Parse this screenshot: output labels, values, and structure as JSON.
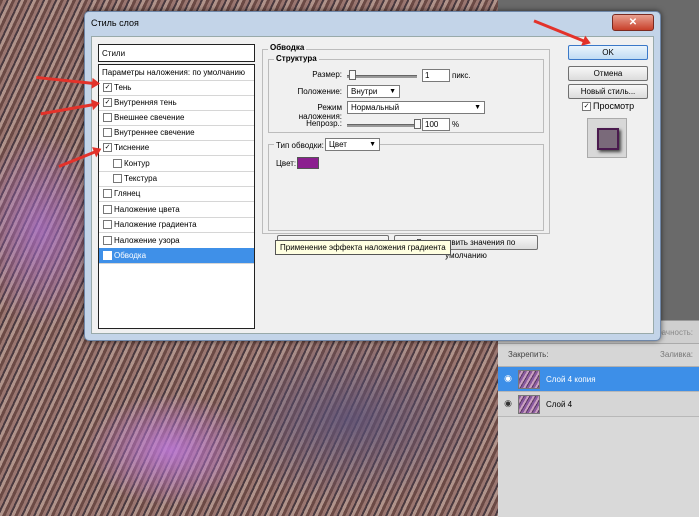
{
  "dialog": {
    "title": "Стиль слоя",
    "close_label": "✕",
    "styles_header": "Стили",
    "styles": [
      {
        "label": "Параметры наложения: по умолчанию",
        "checkbox": false,
        "checked": false
      },
      {
        "label": "Тень",
        "checkbox": true,
        "checked": true
      },
      {
        "label": "Внутренняя тень",
        "checkbox": true,
        "checked": true
      },
      {
        "label": "Внешнее свечение",
        "checkbox": true,
        "checked": false
      },
      {
        "label": "Внутреннее свечение",
        "checkbox": true,
        "checked": false
      },
      {
        "label": "Тиснение",
        "checkbox": true,
        "checked": true
      },
      {
        "label": "Контур",
        "checkbox": true,
        "checked": false
      },
      {
        "label": "Текстура",
        "checkbox": true,
        "checked": false
      },
      {
        "label": "Глянец",
        "checkbox": true,
        "checked": false
      },
      {
        "label": "Наложение цвета",
        "checkbox": true,
        "checked": false
      },
      {
        "label": "Наложение градиента",
        "checkbox": true,
        "checked": false
      },
      {
        "label": "Наложение узора",
        "checkbox": true,
        "checked": false
      },
      {
        "label": "Обводка",
        "checkbox": true,
        "checked": true
      }
    ],
    "stroke": {
      "section_title": "Обводка",
      "structure_title": "Структура",
      "size_label": "Размер:",
      "size_value": "1",
      "size_unit": "пикс.",
      "position_label": "Положение:",
      "position_value": "Внутри",
      "blend_label": "Режим наложения:",
      "blend_value": "Нормальный",
      "opacity_label": "Непрозр.:",
      "opacity_value": "100",
      "opacity_unit": "%",
      "fill_type_label": "Тип обводки:",
      "fill_type_value": "Цвет",
      "color_label": "Цвет:",
      "color_value": "#8b1f8f",
      "reset_button": "Восстановить значения по умолчанию",
      "set_default_button": "…по умолчанию"
    },
    "tooltip": "Применение эффекта наложения градиента",
    "buttons": {
      "ok": "OK",
      "cancel": "Отмена",
      "new_style": "Новый стиль...",
      "preview": "Просмотр",
      "preview_checked": true
    }
  },
  "layers": {
    "opacity_label": "рачность:",
    "lock_label": "Закрепить:",
    "fill_label": "Заливка:",
    "items": [
      {
        "name": "Слой 4 копия",
        "active": true
      },
      {
        "name": "Слой 4",
        "active": false
      }
    ]
  },
  "colors": {
    "arrow": "#e3322a",
    "selection": "#3f90e8",
    "stroke_color": "#8b1f8f"
  }
}
